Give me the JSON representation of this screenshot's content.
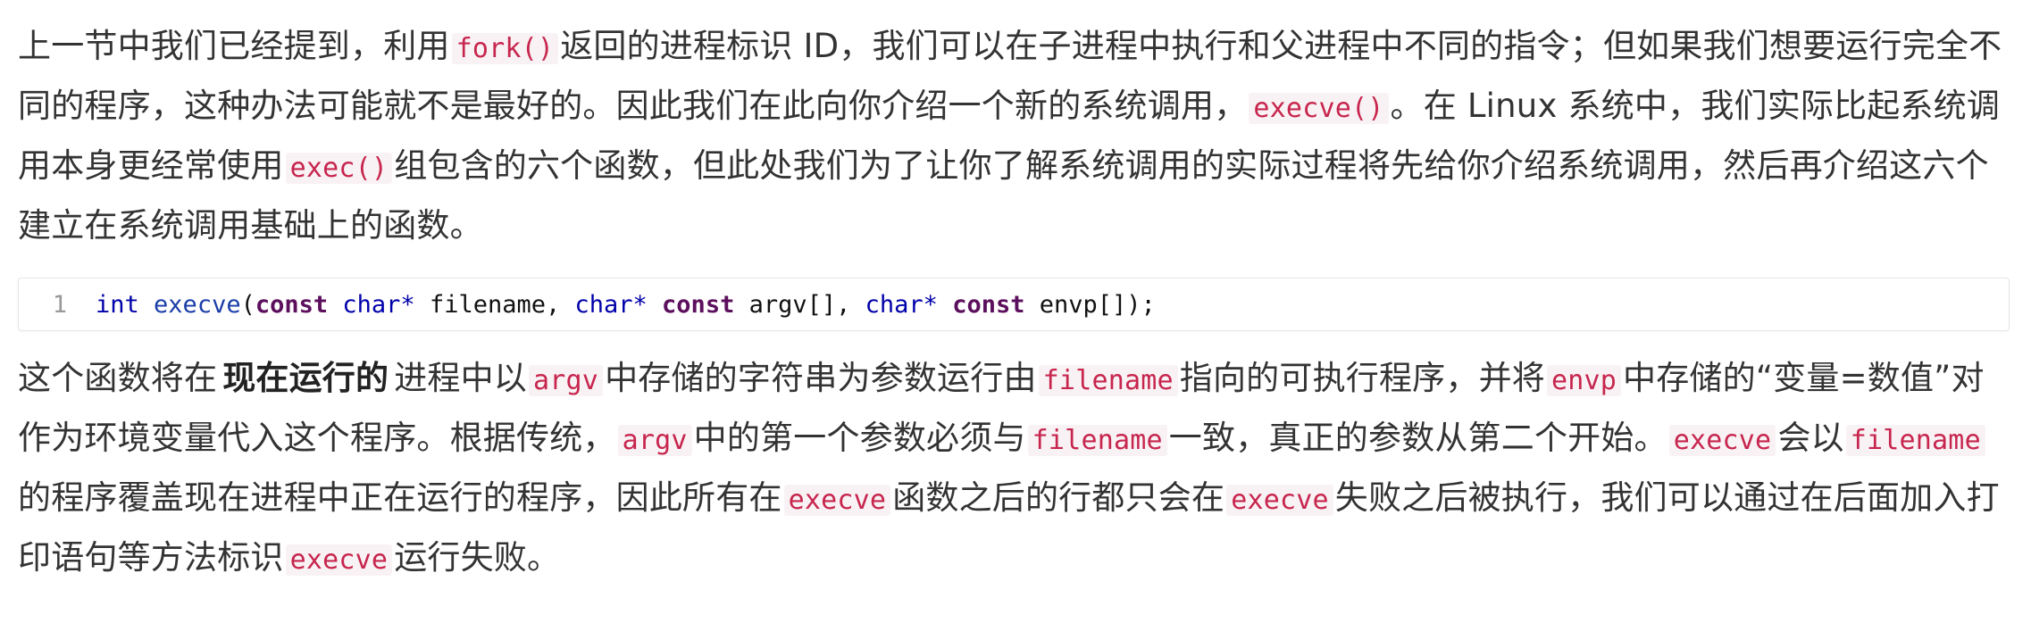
{
  "colors": {
    "inline_code_text": "#c7254e",
    "inline_code_bg": "#f9f2f4",
    "body_text": "#333333",
    "type_keyword": "#0000aa",
    "const_keyword": "#5c0f5c"
  },
  "para1": {
    "t1": "上一节中我们已经提到，利用",
    "c1": "fork()",
    "t2": "返回的进程标识 ID，我们可以在子进程中执行和父进程中不同的指令；但如果我们想要运行完全不同的程序，这种办法可能就不是最好的。因此我们在此向你介绍一个新的系统调用，",
    "c2": "execve()",
    "t3": "。在 Linux 系统中，我们实际比起系统调用本身更经常使用",
    "c3": "exec()",
    "t4": "组包含的六个函数，但此处我们为了让你了解系统调用的实际过程将先给你介绍系统调用，然后再介绍这六个建立在系统调用基础上的函数。"
  },
  "code_block": {
    "line_number": "1",
    "tok_int": "int",
    "tok_fn": "execve",
    "tok_open": "(",
    "tok_const1": "const",
    "tok_char1": "char*",
    "tok_filename": " filename, ",
    "tok_char2": "char*",
    "tok_const2": "const",
    "tok_argv": " argv[], ",
    "tok_char3": "char*",
    "tok_const3": "const",
    "tok_envp": " envp[]);"
  },
  "para2": {
    "t1": "这个函数将在",
    "bold": "现在运行的",
    "t2": "进程中以",
    "c1": "argv",
    "t3": "中存储的字符串为参数运行由",
    "c2": "filename",
    "t4": "指向的可执行程序，并将",
    "c3": "envp",
    "t5": "中存储的“变量=数值”对作为环境变量代入这个程序。根据传统，",
    "c4": "argv",
    "t6": "中的第一个参数必须与",
    "c5": "filename",
    "t7": "一致，真正的参数从第二个开始。",
    "c6": "execve",
    "t8": "会以",
    "c7": "filename",
    "t9": "的程序覆盖现在进程中正在运行的程序，因此所有在",
    "c8": "execve",
    "t10": "函数之后的行都只会在",
    "c9": "execve",
    "t11": "失败之后被执行，我们可以通过在后面加入打印语句等方法标识",
    "c10": "execve",
    "t12": "运行失败。"
  }
}
